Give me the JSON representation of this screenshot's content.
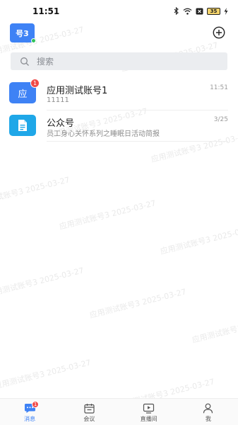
{
  "status_bar": {
    "time": "11:51",
    "battery": "35",
    "icons": [
      "bluetooth-icon",
      "wifi-icon",
      "notification-x-icon",
      "battery-icon",
      "charging-icon"
    ]
  },
  "header": {
    "avatar_label": "号3",
    "avatar_color": "#3e82f5",
    "online_color": "#2ec159",
    "add_icon": "plus-circle-icon"
  },
  "search": {
    "placeholder": "搜索"
  },
  "conversations": [
    {
      "avatar": "应",
      "badge": "1",
      "title": "应用测试账号1",
      "preview": "11111",
      "time": "11:51"
    },
    {
      "avatar_icon": "document-icon",
      "title": "公众号",
      "preview": "员工身心关怀系列之睡眠日活动简报",
      "time": "3/25"
    }
  ],
  "watermark": "应用测试账号3 2025-03-27",
  "tabs": [
    {
      "label": "消息",
      "icon": "chat-icon",
      "active": true,
      "badge": "1"
    },
    {
      "label": "会议",
      "icon": "calendar-icon",
      "active": false
    },
    {
      "label": "直播间",
      "icon": "live-tv-icon",
      "active": false
    },
    {
      "label": "我",
      "icon": "person-icon",
      "active": false
    }
  ],
  "colors": {
    "accent": "#3e82f5",
    "badge": "#f04a48"
  }
}
